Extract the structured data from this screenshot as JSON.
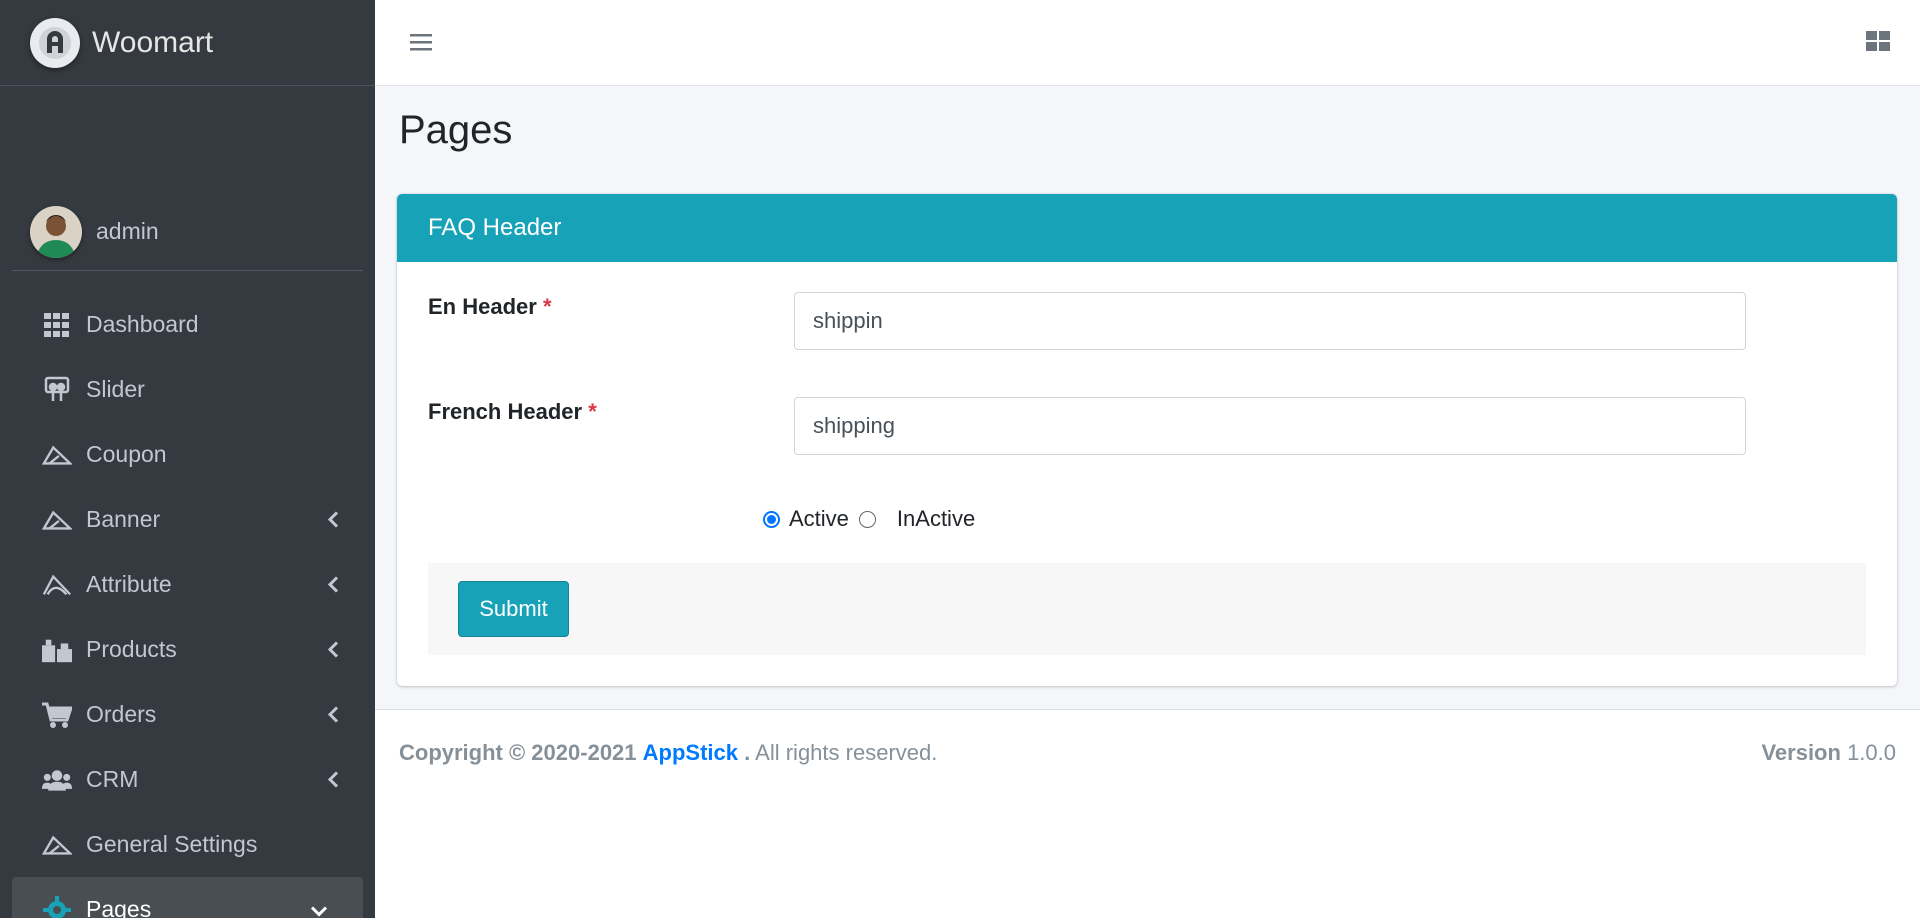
{
  "brand": {
    "name": "Woomart"
  },
  "user": {
    "name": "admin"
  },
  "sidebar": {
    "items": [
      {
        "label": "Dashboard",
        "icon": "grid-icon",
        "has_children": false
      },
      {
        "label": "Slider",
        "icon": "slideshare-icon",
        "has_children": false
      },
      {
        "label": "Coupon",
        "icon": "coupon-icon",
        "has_children": false
      },
      {
        "label": "Banner",
        "icon": "banner-icon",
        "has_children": true
      },
      {
        "label": "Attribute",
        "icon": "attribute-icon",
        "has_children": true
      },
      {
        "label": "Products",
        "icon": "gifts-icon",
        "has_children": true
      },
      {
        "label": "Orders",
        "icon": "cart-icon",
        "has_children": true
      },
      {
        "label": "CRM",
        "icon": "users-icon",
        "has_children": true
      },
      {
        "label": "General Settings",
        "icon": "settings-icon",
        "has_children": false
      },
      {
        "label": "Pages",
        "icon": "cog-icon",
        "has_children": true,
        "active": true
      }
    ]
  },
  "page": {
    "title": "Pages"
  },
  "card": {
    "title": "FAQ Header",
    "fields": [
      {
        "label": "En Header",
        "required_mark": "*",
        "value": "shippin"
      },
      {
        "label": "French Header",
        "required_mark": "*",
        "value": "shipping"
      }
    ],
    "status": {
      "options": [
        "Active",
        "InActive"
      ],
      "selected": "Active"
    },
    "submit_label": "Submit"
  },
  "footer": {
    "copyright_prefix": "Copyright © 2020-2021",
    "company": "AppStick",
    "period": ".",
    "rights": "All rights reserved.",
    "version_label": "Version",
    "version_value": "1.0.0"
  },
  "colors": {
    "sidebar_bg": "#343a40",
    "accent": "#17a2b8",
    "link": "#007bff",
    "required": "#dc3545"
  }
}
